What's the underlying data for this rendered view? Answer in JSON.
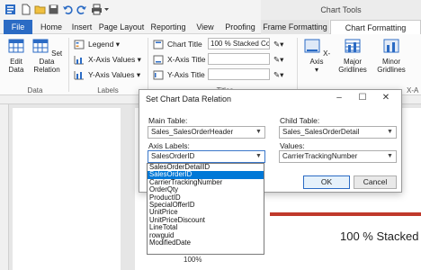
{
  "ribbon_tabs": {
    "file": "File",
    "home": "Home",
    "insert": "Insert",
    "page_layout": "Page Layout",
    "reporting": "Reporting",
    "view": "View",
    "proofing": "Proofing",
    "frame_formatting": "Frame Formatting",
    "chart_formatting": "Chart Formatting",
    "chart_tools": "Chart Tools"
  },
  "ribbon": {
    "edit_data": "Edit Data",
    "set_data_relation": "Set Data Relation",
    "data_group": "Data",
    "legend": "Legend",
    "x_axis_values": "X-Axis Values",
    "y_axis_values": "Y-Axis Values",
    "labels_group": "Labels",
    "chart_title": "Chart Title",
    "x_axis_title": "X-Axis Title",
    "y_axis_title": "Y-Axis Title",
    "chart_title_value": "100 % Stacked Co",
    "titles_group": "Titles",
    "x_axis": "X-Axis",
    "major_gridlines": "Major Gridlines",
    "minor_gridlines": "Minor Gridlines",
    "x_a_cut": "X-A"
  },
  "dialog": {
    "title": "Set Chart Data Relation",
    "main_table_label": "Main Table:",
    "main_table_value": "Sales_SalesOrderHeader",
    "child_table_label": "Child Table:",
    "child_table_value": "Sales_SalesOrderDetail",
    "axis_labels_label": "Axis Labels:",
    "axis_labels_value": "SalesOrderID",
    "values_label": "Values:",
    "values_value": "CarrierTrackingNumber",
    "ok": "OK",
    "cancel": "Cancel"
  },
  "dropdown_items": [
    "SalesOrderDetailID",
    "SalesOrderID",
    "CarrierTrackingNumber",
    "OrderQty",
    "ProductID",
    "SpecialOfferID",
    "UnitPrice",
    "UnitPriceDiscount",
    "LineTotal",
    "rowguid",
    "ModifiedDate"
  ],
  "dropdown_selected_index": 1,
  "document": {
    "chart_title": "100 % Stacked",
    "pct_label": "100%"
  },
  "colors": {
    "file_tab": "#2b6bc4",
    "selection": "#0078d7"
  }
}
